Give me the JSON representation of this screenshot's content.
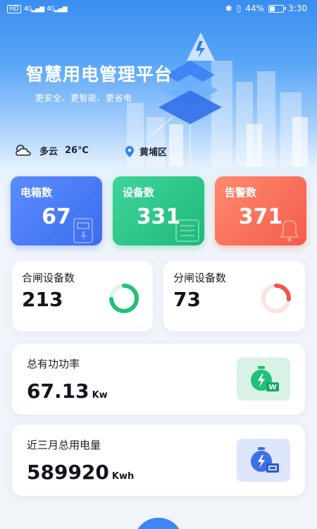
{
  "status_bar": {
    "left_chip": "HD",
    "signal_1": "4G",
    "signal_2": "4G",
    "battery_text": "44%",
    "battery_level": 0.44,
    "time": "3:30"
  },
  "banner": {
    "title": "智慧用电管理平台",
    "subtitle": "更安全、更智能、更省电"
  },
  "weather": {
    "condition": "多云",
    "temperature": "26℃",
    "location": "黄埔区"
  },
  "stats": [
    {
      "label": "电箱数",
      "value": "67",
      "color": "#4a7cf6"
    },
    {
      "label": "设备数",
      "value": "331",
      "color": "#2ac586"
    },
    {
      "label": "告警数",
      "value": "371",
      "color": "#f76e57"
    }
  ],
  "switch_cards": {
    "closed": {
      "label": "合闸设备数",
      "value": "213",
      "ratio": 0.74,
      "color": "#22c07a"
    },
    "open": {
      "label": "分闸设备数",
      "value": "73",
      "ratio": 0.26,
      "color": "#f0564a"
    }
  },
  "power": {
    "label": "总有功功率",
    "value": "67.13",
    "unit": "Kw",
    "badge": "W"
  },
  "energy": {
    "label": "近三月总用电量",
    "value": "589920",
    "unit": "Kwh"
  }
}
